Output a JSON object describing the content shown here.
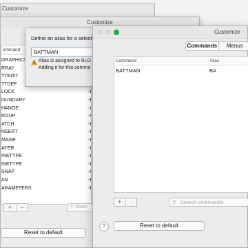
{
  "back_window": {
    "title": "Customize"
  },
  "mid_window": {
    "title": "Customize",
    "list_header": "ommand",
    "rows": [
      {
        "cmd": "GRAPHICS",
        "alias": ""
      },
      {
        "cmd": "RRAY",
        "alias": ""
      },
      {
        "cmd": "TTEDIT",
        "alias": ""
      },
      {
        "cmd": "TTDEF",
        "alias": ""
      },
      {
        "cmd": "LOCK",
        "alias": "-E"
      },
      {
        "cmd": "OUNDARY",
        "alias": "-E"
      },
      {
        "cmd": "HANGE",
        "alias": "-C"
      },
      {
        "cmd": "ROUP",
        "alias": "-C"
      },
      {
        "cmd": "ATCH",
        "alias": "-H"
      },
      {
        "cmd": "NSERT",
        "alias": "-I"
      },
      {
        "cmd": "MAGE",
        "alias": "-I"
      },
      {
        "cmd": "AYER",
        "alias": "-L"
      },
      {
        "cmd": "INETYPE",
        "alias": "-L"
      },
      {
        "cmd": "INETYPE",
        "alias": "-L"
      },
      {
        "cmd": "SNAP",
        "alias": "-C"
      },
      {
        "cmd": "AN",
        "alias": "-F"
      },
      {
        "cmd": "ARAMETERS",
        "alias": "-F"
      }
    ],
    "plus": "+",
    "minus": "−",
    "search_placeholder": "Searc",
    "reset_label": "Reset to default"
  },
  "dialog": {
    "title": "Define an alias for a selecte",
    "input_value": "BATTMAN",
    "warning_line1": "Alias is assigned to BLO",
    "warning_line2": "Adding it for this comma"
  },
  "front_window": {
    "title": "Customize",
    "tabs": [
      {
        "label": "Commands",
        "active": true
      },
      {
        "label": "Menus",
        "active": false
      }
    ],
    "table_headers": {
      "command": "Command",
      "alias": "Alias"
    },
    "rows": [
      {
        "command": "BATTMAN",
        "alias": "BA"
      }
    ],
    "plus": "+",
    "minus": "−",
    "search_placeholder": "Search commands",
    "help": "?",
    "reset_label": "Reset to default"
  },
  "colors": {
    "zoom_dot": "#2bb240",
    "warning": "#e0a800",
    "accent": "#4a78c9"
  }
}
